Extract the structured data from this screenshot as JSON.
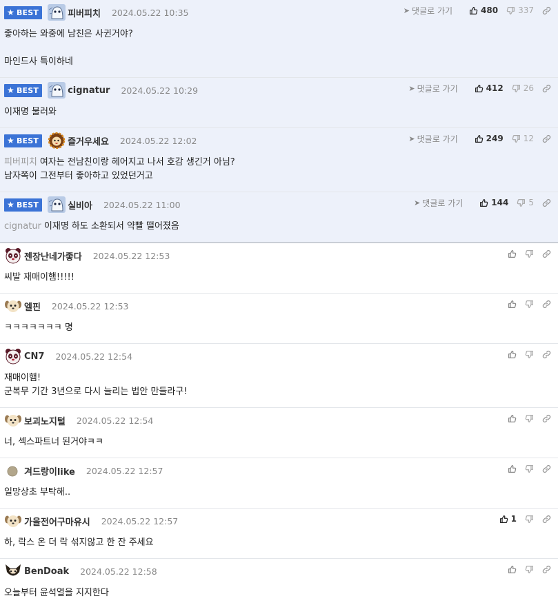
{
  "ui": {
    "best_label": "BEST",
    "goto_label": "댓글로 가기"
  },
  "comments": [
    {
      "best": true,
      "avatar": "ghost",
      "nick": "피버피치",
      "date": "2024.05.22 10:35",
      "mention": "",
      "text": "좋아하는 와중에 남친은 사귄거야?\n\n마인드사 특이하네",
      "up": "480",
      "down": "337"
    },
    {
      "best": true,
      "avatar": "ghost",
      "nick": "cignatur",
      "date": "2024.05.22 10:29",
      "mention": "",
      "text": "이재명 불러와",
      "up": "412",
      "down": "26"
    },
    {
      "best": true,
      "avatar": "lion",
      "nick": "즐거우세요",
      "date": "2024.05.22 12:02",
      "mention": "피버피치",
      "text": "여자는 전남친이랑 헤어지고 나서 호감 생긴거 아님?\n남자쪽이 그전부터 좋아하고 있었던거고",
      "up": "249",
      "down": "12"
    },
    {
      "best": true,
      "avatar": "ghost",
      "nick": "실비아",
      "date": "2024.05.22 11:00",
      "mention": "cignatur",
      "text": "이재명 하도 소환되서 약빨 떨어졌음",
      "up": "144",
      "down": "5"
    },
    {
      "best": false,
      "avatar": "panda",
      "nick": "젠장난네가좋다",
      "date": "2024.05.22 12:53",
      "mention": "",
      "text": "씨발 재매이햄!!!!!",
      "up": "",
      "down": ""
    },
    {
      "best": false,
      "avatar": "dog",
      "nick": "엘핀",
      "date": "2024.05.22 12:53",
      "mention": "",
      "text": "ㅋㅋㅋㅋㅋㅋㅋ 명",
      "up": "",
      "down": ""
    },
    {
      "best": false,
      "avatar": "panda",
      "nick": "CN7",
      "date": "2024.05.22 12:54",
      "mention": "",
      "text": "재매이햄!\n군복무 기간 3년으로 다시 늘리는 법안 만들라구!",
      "up": "",
      "down": ""
    },
    {
      "best": false,
      "avatar": "dog",
      "nick": "보괴노지털",
      "date": "2024.05.22 12:54",
      "mention": "",
      "text": "너, 섹스파트너 된거야ㅋㅋ",
      "up": "",
      "down": ""
    },
    {
      "best": false,
      "avatar": "circle",
      "nick": "겨드랑이like",
      "date": "2024.05.22 12:57",
      "mention": "",
      "text": "일망상초 부탁해..",
      "up": "",
      "down": ""
    },
    {
      "best": false,
      "avatar": "dog",
      "nick": "가을전어구마유시",
      "date": "2024.05.22 12:57",
      "mention": "",
      "text": "하, 락스 온 더 락 섞지않고 한 잔 주세요",
      "up": "1",
      "down": ""
    },
    {
      "best": false,
      "avatar": "fox",
      "nick": "BenDoak",
      "date": "2024.05.22 12:58",
      "mention": "",
      "text": "오늘부터 윤석열을 지지한다",
      "up": "",
      "down": ""
    }
  ]
}
